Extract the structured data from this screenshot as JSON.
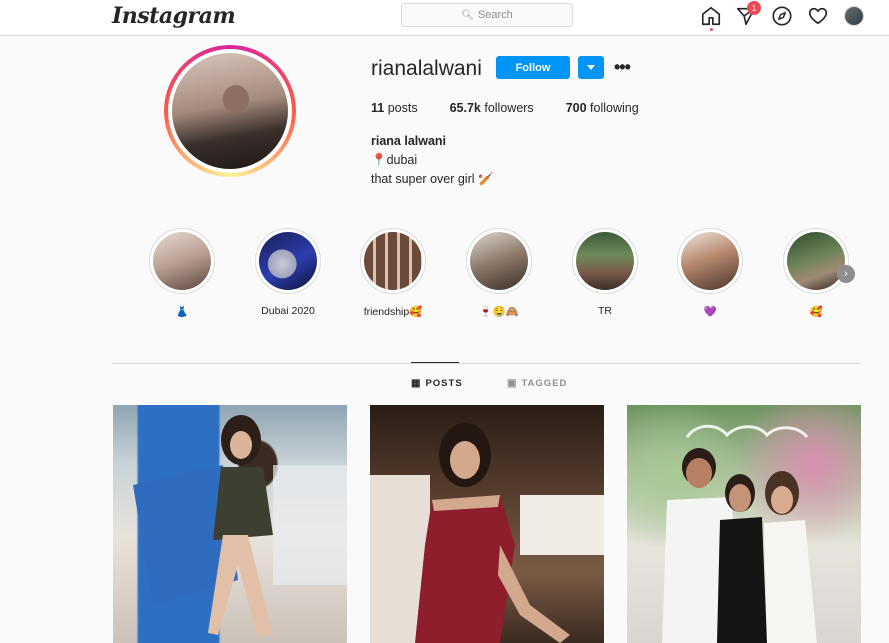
{
  "nav": {
    "logo": "Instagram",
    "search_placeholder": "Search",
    "notification_count": "1"
  },
  "profile": {
    "username": "rianalalwani",
    "follow_label": "Follow",
    "stats": [
      {
        "value": "11",
        "label": "posts"
      },
      {
        "value": "65.7k",
        "label": "followers"
      },
      {
        "value": "700",
        "label": "following"
      }
    ],
    "full_name": "riana lalwani",
    "bio": [
      "📍dubai",
      "that super over girl 🏏"
    ]
  },
  "highlights": [
    {
      "label": "👗"
    },
    {
      "label": "Dubai 2020"
    },
    {
      "label": "friendship🥰"
    },
    {
      "label": "🍷🤤🙈"
    },
    {
      "label": "TR"
    },
    {
      "label": "💜"
    },
    {
      "label": "🥰"
    }
  ],
  "tabs": {
    "posts": "POSTS",
    "tagged": "TAGGED"
  },
  "colors": {
    "accent": "#0095f6",
    "badge": "#ed4956"
  }
}
